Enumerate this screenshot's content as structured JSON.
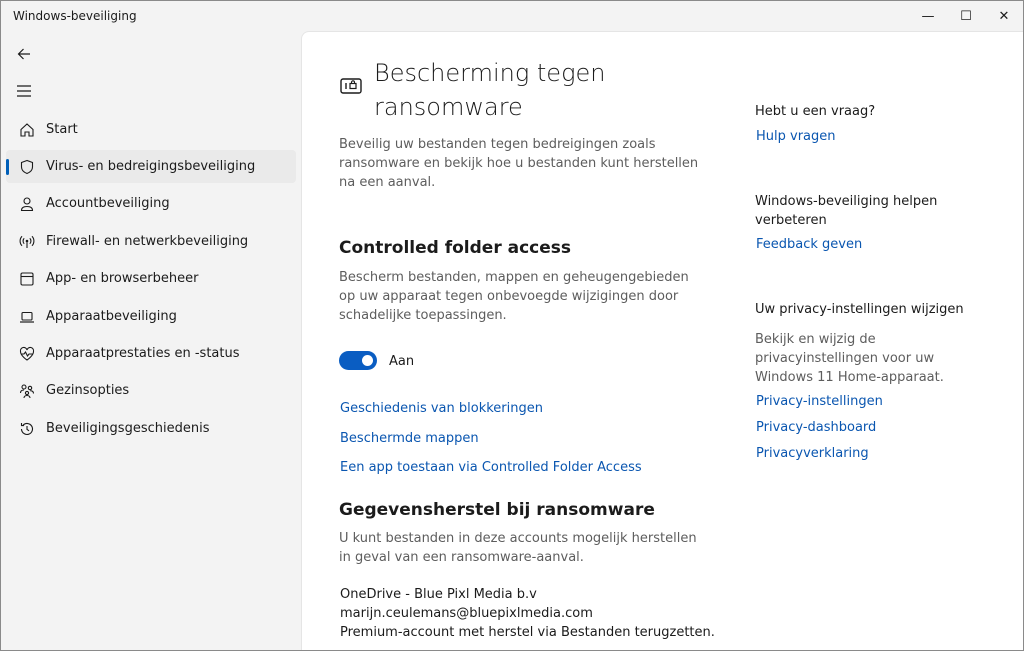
{
  "window": {
    "title": "Windows-beveiliging",
    "controls": {
      "minimize": "—",
      "maximize": "☐",
      "close": "✕"
    }
  },
  "nav": {
    "back_icon": "back-arrow-icon",
    "menu_icon": "hamburger-icon",
    "items": [
      {
        "label": "Start",
        "icon": "home-icon"
      },
      {
        "label": "Virus- en bedreigingsbeveiliging",
        "icon": "shield-icon",
        "active": true
      },
      {
        "label": "Accountbeveiliging",
        "icon": "person-icon"
      },
      {
        "label": "Firewall- en netwerkbeveiliging",
        "icon": "antenna-icon"
      },
      {
        "label": "App- en browserbeheer",
        "icon": "browser-window-icon"
      },
      {
        "label": "Apparaatbeveiliging",
        "icon": "laptop-icon"
      },
      {
        "label": "Apparaatprestaties en -status",
        "icon": "heart-pulse-icon"
      },
      {
        "label": "Gezinsopties",
        "icon": "family-icon"
      },
      {
        "label": "Beveiligingsgeschiedenis",
        "icon": "history-icon"
      }
    ]
  },
  "main": {
    "title": "Bescherming tegen ransomware",
    "intro": "Beveilig uw bestanden tegen bedreigingen zoals ransomware en bekijk hoe u bestanden kunt herstellen na een aanval.",
    "cfa": {
      "heading": "Controlled folder access",
      "description": "Bescherm bestanden, mappen en geheugengebieden op uw apparaat tegen onbevoegde wijzigingen door schadelijke toepassingen.",
      "toggle_state": "Aan",
      "toggle_on": true,
      "links": [
        "Geschiedenis van blokkeringen",
        "Beschermde mappen",
        "Een app toestaan via Controlled Folder Access"
      ]
    },
    "recovery": {
      "heading": "Gegevensherstel bij ransomware",
      "description": "U kunt bestanden in deze accounts mogelijk herstellen in geval van een ransomware-aanval.",
      "account_name": "OneDrive - Blue Pixl Media b.v",
      "account_email": "marijn.ceulemans@bluepixlmedia.com",
      "account_type": "Premium-account met herstel via Bestanden terugzetten."
    }
  },
  "aside": {
    "question_heading": "Hebt u een vraag?",
    "help_link": "Hulp vragen",
    "improve_heading": "Windows-beveiliging helpen verbeteren",
    "feedback_link": "Feedback geven",
    "privacy_heading": "Uw privacy-instellingen wijzigen",
    "privacy_text": "Bekijk en wijzig de privacyinstellingen voor uw Windows 11 Home-apparaat.",
    "privacy_links": [
      "Privacy-instellingen",
      "Privacy-dashboard",
      "Privacyverklaring"
    ]
  },
  "colors": {
    "accent": "#0a5dc2",
    "link": "#0a56b0",
    "nav_bg": "#f3f3f3"
  }
}
